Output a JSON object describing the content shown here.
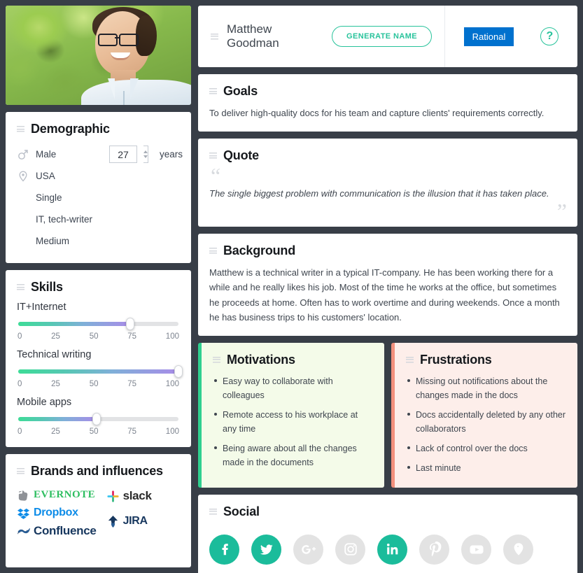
{
  "header": {
    "name": "Matthew Goodman",
    "generate_button": "GENERATE NAME",
    "badge": "Rational",
    "help_icon": "?"
  },
  "demographic": {
    "title": "Demographic",
    "gender": "Male",
    "gender_icon": "mars-icon",
    "age_value": "27",
    "age_unit": "years",
    "location": "USA",
    "location_icon": "map-pin-icon",
    "marital_status": "Single",
    "occupation": "IT, tech-writer",
    "income": "Medium"
  },
  "skills": {
    "title": "Skills",
    "ticks": [
      "0",
      "25",
      "50",
      "75",
      "100"
    ],
    "items": [
      {
        "label": "IT+Internet",
        "value": 70
      },
      {
        "label": "Technical writing",
        "value": 100
      },
      {
        "label": "Mobile apps",
        "value": 49
      }
    ]
  },
  "brands": {
    "title": "Brands and influences",
    "col1": [
      "EVERNOTE",
      "Dropbox",
      "Confluence"
    ],
    "col2": [
      "slack",
      "JIRA"
    ]
  },
  "goals": {
    "title": "Goals",
    "text": "To deliver high-quality docs for his team and capture clients' requirements correctly."
  },
  "quote": {
    "title": "Quote",
    "open_mark": "“",
    "close_mark": "”",
    "text": "The single biggest problem with communication is the illusion that it has taken place."
  },
  "background": {
    "title": "Background",
    "text": "Matthew is a technical writer in a typical IT-company. He has been working there for a while and he really likes his job. Most of the time he works at the office, but sometimes he proceeds at home. Often has to work overtime and during weekends. Once a month he has business trips to his customers' location."
  },
  "motivations": {
    "title": "Motivations",
    "items": [
      "Easy way to collaborate with colleagues",
      "Remote access to his workplace at any time",
      "Being aware about all the changes made in the documents"
    ]
  },
  "frustrations": {
    "title": "Frustrations",
    "items": [
      "Missing out notifications about the changes made in the docs",
      "Docs accidentally deleted by any other collaborators",
      "Lack of control over the docs",
      "Last minute"
    ]
  },
  "social": {
    "title": "Social",
    "networks": [
      {
        "name": "facebook",
        "active": true
      },
      {
        "name": "twitter",
        "active": true
      },
      {
        "name": "google-plus",
        "active": false
      },
      {
        "name": "instagram",
        "active": false
      },
      {
        "name": "linkedin",
        "active": true
      },
      {
        "name": "pinterest",
        "active": false
      },
      {
        "name": "youtube",
        "active": false
      },
      {
        "name": "periscope",
        "active": false
      }
    ]
  },
  "colors": {
    "page_bg": "#383e47",
    "accent_teal": "#28c39b",
    "badge_blue": "#0071ce",
    "motivation_green": "#2fcf8f",
    "frustration_salmon": "#f2907d"
  }
}
